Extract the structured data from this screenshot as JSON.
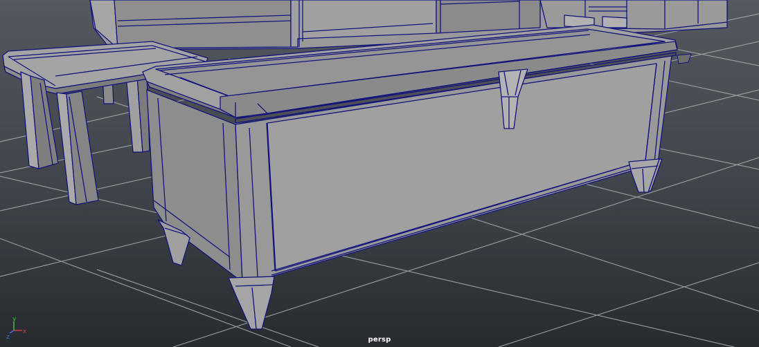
{
  "viewport": {
    "camera_label": "persp",
    "axis": {
      "x_label": "x",
      "y_label": "y",
      "z_label": "z"
    }
  },
  "colors": {
    "background_top": "#52575d",
    "background_bottom": "#25292e",
    "grid": "#9ea3a8",
    "surface": "#9c9c9c",
    "surface_light": "#a9a9a9",
    "surface_dark": "#848484",
    "wire": "#12127a",
    "axis_x": "#d23b3b",
    "axis_y": "#3fc43f",
    "axis_z": "#3c6de0"
  }
}
